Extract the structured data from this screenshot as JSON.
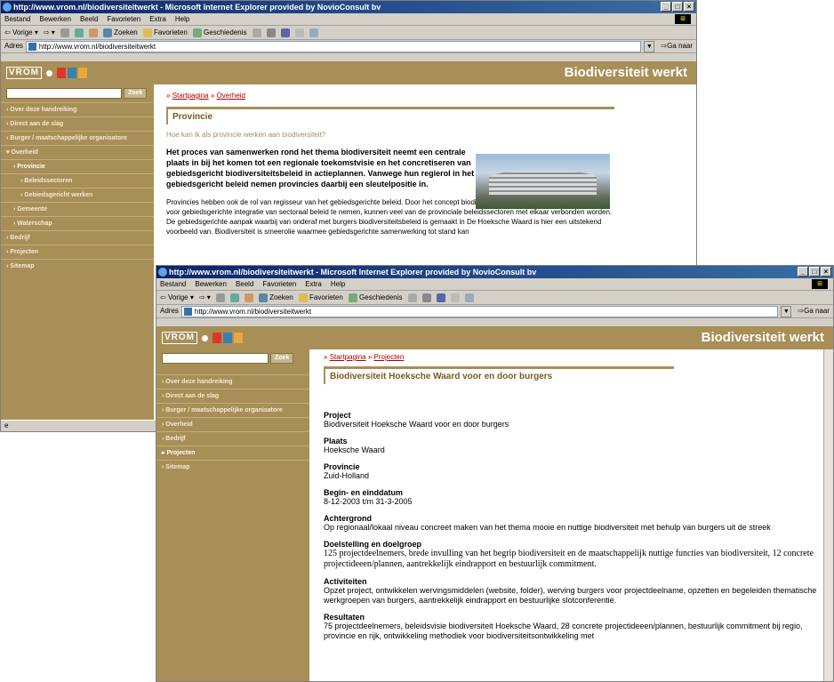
{
  "back_window": {
    "title": "http://www.vrom.nl/biodiversiteitwerkt - Microsoft Internet Explorer provided by NovioConsult bv",
    "menu": [
      "Bestand",
      "Bewerken",
      "Beeld",
      "Favorieten",
      "Extra",
      "Help"
    ],
    "toolbar": {
      "back": "Vorige",
      "search": "Zoeken",
      "favorites": "Favorieten",
      "history": "Geschiedenis"
    },
    "address_label": "Adres",
    "address_value": "http://www.vrom.nl/biodiversiteitwerkt",
    "go_label": "Ga naar",
    "logo_text": "VROM",
    "site_title": "Biodiversiteit werkt",
    "search_button": "Zoek",
    "nav": [
      "Over deze handreiking",
      "Direct aan de slag",
      "Burger / maatschappelijke organisatore",
      "Overheid",
      "Provincie",
      "Beleidssectoren",
      "Gebiedsgericht werken",
      "Gemeente",
      "Waterschap",
      "Bedrijf",
      "Projecten",
      "Sitemap"
    ],
    "breadcrumb_prefix": "»",
    "breadcrumb": [
      "Startpagina",
      "Overheid"
    ],
    "section_title": "Provincie",
    "question": "Hoe kan ik als provincie werken aan biodiversiteit?",
    "lead": "Het proces van samenwerken rond het thema biodiversiteit neemt een centrale plaats in bij het komen tot een regionale toekomstvisie en het concretiseren van gebiedsgericht biodiversiteitsbeleid in actieplannen. Vanwege hun regierol in het gebiedsgericht beleid nemen provincies daarbij een sleutelpositie in.",
    "body": "Provincies hebben ook de rol van regisseur van het gebiedsgerichte beleid. Door het concept biodiversiteit als fundamenteel uitgangspunt voor gebiedsgerichte integratie van sectoraal beleid te nemen, kunnen veel van de provinciale beleidssectoren met elkaar verbonden worden. De gebiedsgerichte aanpak waarbij van onderaf met burgers biodiversiteitsbeleid is gemaakt in De Hoeksche Waard is hier een uitstekend voorbeeld van. Biodiversiteit is smeerolie waarmee gebiedsgerichte samenwerking tot stand kan"
  },
  "front_window": {
    "title": "http://www.vrom.nl/biodiversiteitwerkt - Microsoft Internet Explorer provided by NovioConsult bv",
    "menu": [
      "Bestand",
      "Bewerken",
      "Beeld",
      "Favorieten",
      "Extra",
      "Help"
    ],
    "toolbar": {
      "back": "Vorige",
      "search": "Zoeken",
      "favorites": "Favorieten",
      "history": "Geschiedenis"
    },
    "address_label": "Adres",
    "address_value": "http://www.vrom.nl/biodiversiteitwerkt",
    "go_label": "Ga naar",
    "logo_text": "VROM",
    "site_title": "Biodiversiteit werkt",
    "search_button": "Zoek",
    "nav": [
      "Over deze handreiking",
      "Direct aan de slag",
      "Burger / maatschappelijke organisatore",
      "Overheid",
      "Bedrijf",
      "Projecten",
      "Sitemap"
    ],
    "breadcrumb_prefix": "»",
    "breadcrumb": [
      "Startpagina",
      "Projecten"
    ],
    "section_title": "Biodiversiteit Hoeksche Waard voor en door burgers",
    "fields": [
      {
        "label": "Project",
        "value": "Biodiversiteit Hoeksche Waard voor en door burgers"
      },
      {
        "label": "Plaats",
        "value": "Hoeksche Waard"
      },
      {
        "label": "Provincie",
        "value": "Zuid-Holland"
      },
      {
        "label": "Begin- en einddatum",
        "value": "8-12-2003 t/m 31-3-2005"
      },
      {
        "label": "Achtergrond",
        "value": "Op regionaal/lokaal niveau concreet maken van het thema mooie en nuttige biodiversiteit met behulp van burgers uit de streek"
      },
      {
        "label": "Doelstelling en doelgroep",
        "value": "125 projectdeelnemers, brede invulling van het begrip biodiversiteit en de maatschappelijk nuttige functies van biodiversiteit, 12 concrete projectideeen/plannen, aantrekkelijk eindrapport en bestuurlijk commitment."
      },
      {
        "label": "Activiteiten",
        "value": "Opzet project, ontwikkelen wervingsmiddelen (website, folder), werving burgers voor projectdeelname, opzetten en begeleiden thematische werkgroepen van burgers, aantrekkelijk eindrapport en bestuurlijke slotconferentie."
      },
      {
        "label": "Resultaten",
        "value": "75 projectdeelnemers, beleidsvisie biodiversiteit Hoeksche Waard, 28 concrete projectideeen/plannen, bestuurlijk commitment bij regio, provincie en rijk, ontwikkeling methodiek voor biodiversiteitsontwikkeling met"
      }
    ]
  },
  "colors": {
    "brand": "#a88f57",
    "title_gradient_start": "#0a246a",
    "title_gradient_end": "#3a6ea5",
    "logo_squares": [
      "#d9382b",
      "#3a7fb0",
      "#e8a93a"
    ]
  }
}
